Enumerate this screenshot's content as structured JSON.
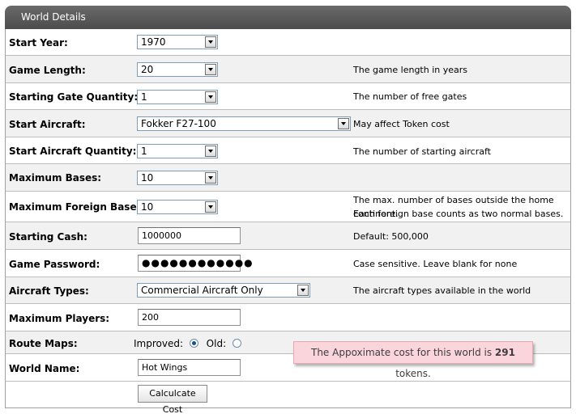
{
  "panel": {
    "title": "World Details"
  },
  "fields": {
    "start_year": {
      "label": "Start Year:",
      "value": "1970"
    },
    "game_length": {
      "label": "Game Length:",
      "value": "20",
      "help": "The game length in years"
    },
    "gate_qty": {
      "label": "Starting Gate Quantity:",
      "value": "1",
      "help": "The number of free gates"
    },
    "start_aircraft": {
      "label": "Start Aircraft:",
      "value": "Fokker F27-100",
      "help": "May affect Token cost"
    },
    "aircraft_qty": {
      "label": "Start Aircraft Quantity:",
      "value": "1",
      "help": "The number of starting aircraft"
    },
    "max_bases": {
      "label": "Maximum Bases:",
      "value": "10"
    },
    "max_foreign": {
      "label": "Maximum Foreign Bases:",
      "value": "10",
      "help1": "The max. number of bases outside the home continent.",
      "help2": "Each foreign base counts as two normal bases."
    },
    "starting_cash": {
      "label": "Starting Cash:",
      "value": "1000000",
      "help": "Default: 500,000"
    },
    "password": {
      "label": "Game Password:",
      "value": "●●●●●●●●●●●●",
      "help": "Case sensitive. Leave blank for none"
    },
    "aircraft_types": {
      "label": "Aircraft Types:",
      "value": "Commercial Aircraft Only",
      "help": "The aircraft types available in the world"
    },
    "max_players": {
      "label": "Maximum Players:",
      "value": "200"
    },
    "route_maps": {
      "label": "Route Maps:",
      "option_improved": "Improved:",
      "option_old": "Old:"
    },
    "world_name": {
      "label": "World Name:",
      "value": "Hot Wings"
    }
  },
  "actions": {
    "calculate_label": "Calculcate Cost"
  },
  "tooltip": {
    "prefix": "The Appoximate cost for this world is ",
    "tokens": "291",
    "suffix": " tokens."
  }
}
